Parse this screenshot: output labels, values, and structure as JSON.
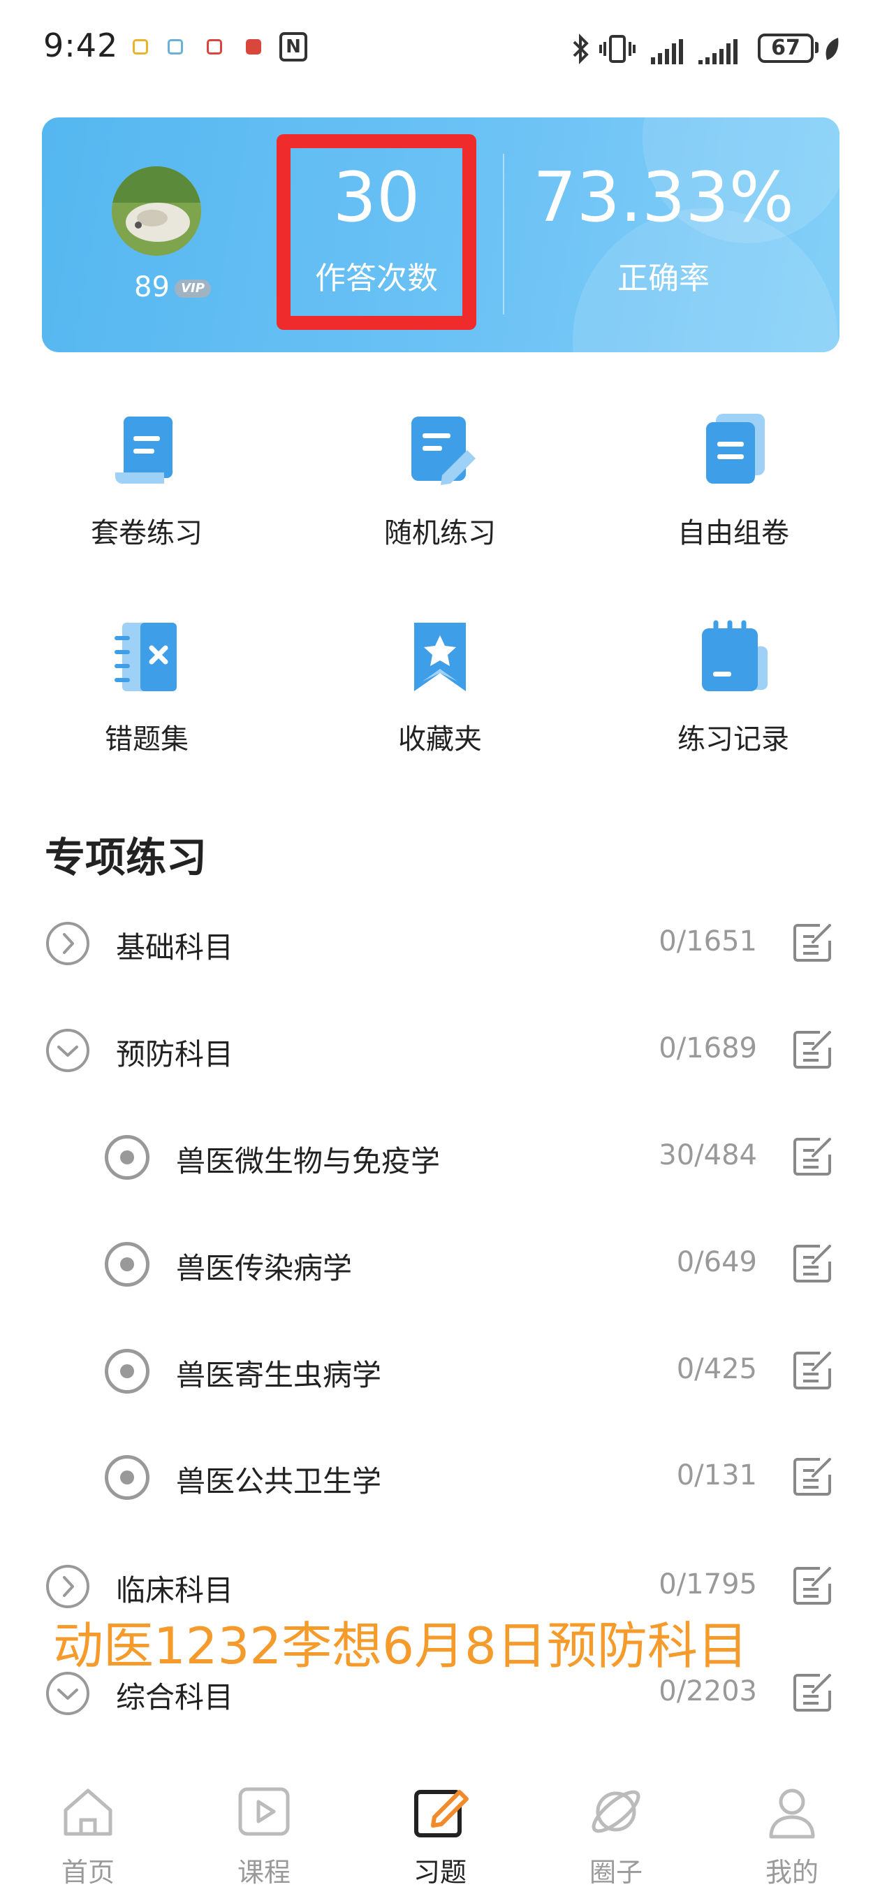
{
  "status_bar": {
    "time": "9:42",
    "battery": "67",
    "notification_icons": [
      "note-icon",
      "message-icon",
      "screen-icon",
      "health-icon"
    ],
    "nfc_label": "N"
  },
  "stats_card": {
    "level": "89",
    "vip_label": "VIP",
    "answer_count": "30",
    "answer_count_label": "作答次数",
    "accuracy": "73.33%",
    "accuracy_label": "正确率",
    "highlight_color": "#ef2b2b",
    "background_color": "#6cc2f5"
  },
  "quick_actions": [
    {
      "label": "套卷练习",
      "icon": "scroll-paper-icon"
    },
    {
      "label": "随机练习",
      "icon": "edit-paper-icon"
    },
    {
      "label": "自由组卷",
      "icon": "stacked-paper-icon"
    },
    {
      "label": "错题集",
      "icon": "wrong-notebook-icon"
    },
    {
      "label": "收藏夹",
      "icon": "bookmark-star-icon"
    },
    {
      "label": "练习记录",
      "icon": "record-notepad-icon"
    }
  ],
  "section": {
    "title": "专项练习",
    "rows": [
      {
        "label": "基础科目",
        "count": "0/1651",
        "type": "collapsed"
      },
      {
        "label": "预防科目",
        "count": "0/1689",
        "type": "expanded"
      },
      {
        "label": "兽医微生物与免疫学",
        "count": "30/484",
        "type": "child"
      },
      {
        "label": "兽医传染病学",
        "count": "0/649",
        "type": "child"
      },
      {
        "label": "兽医寄生虫病学",
        "count": "0/425",
        "type": "child"
      },
      {
        "label": "兽医公共卫生学",
        "count": "0/131",
        "type": "child"
      },
      {
        "label": "临床科目",
        "count": "0/1795",
        "type": "collapsed"
      },
      {
        "label": "综合科目",
        "count": "0/2203",
        "type": "expanded"
      }
    ]
  },
  "overlay_text": "动医1232李想6月8日预防科目",
  "overlay_color": "#f59b2b",
  "bottom_nav": [
    {
      "label": "首页",
      "icon": "home-icon",
      "active": false
    },
    {
      "label": "课程",
      "icon": "course-play-icon",
      "active": false
    },
    {
      "label": "习题",
      "icon": "exercise-edit-icon",
      "active": true
    },
    {
      "label": "圈子",
      "icon": "planet-icon",
      "active": false
    },
    {
      "label": "我的",
      "icon": "profile-icon",
      "active": false
    }
  ]
}
